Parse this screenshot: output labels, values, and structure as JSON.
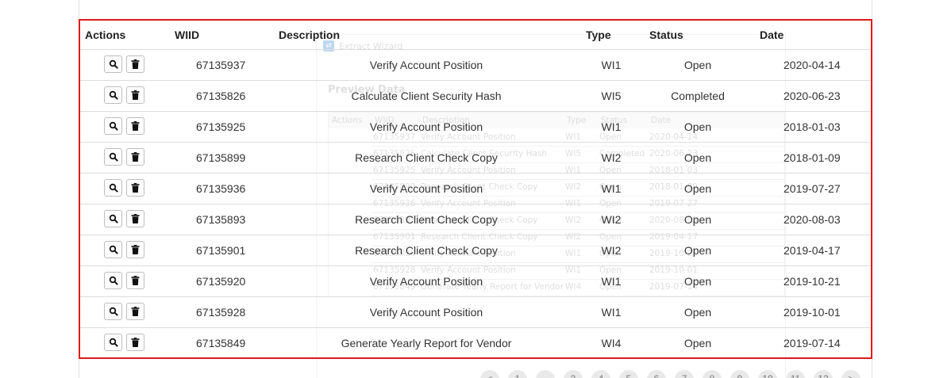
{
  "ghost_dialog": {
    "title": "Extract Wizard",
    "heading": "Preview Data",
    "columns": [
      "Actions",
      "WIID",
      "Description",
      "Type",
      "Status",
      "Date"
    ],
    "rows": [
      {
        "wiid": "67135937",
        "description": "Verify Account Position",
        "type": "WI1",
        "status": "Open",
        "date": "2020-04-14"
      },
      {
        "wiid": "67135826",
        "description": "Calculate Client Security Hash",
        "type": "WI5",
        "status": "Completed",
        "date": "2020-06-23"
      },
      {
        "wiid": "67135925",
        "description": "Verify Account Position",
        "type": "WI1",
        "status": "Open",
        "date": "2018-01-03"
      },
      {
        "wiid": "67135899",
        "description": "Research Client Check Copy",
        "type": "WI2",
        "status": "Open",
        "date": "2018-01-09"
      },
      {
        "wiid": "67135936",
        "description": "Verify Account Position",
        "type": "WI1",
        "status": "Open",
        "date": "2019-07-27"
      },
      {
        "wiid": "67135893",
        "description": "Research Client Check Copy",
        "type": "WI2",
        "status": "Open",
        "date": "2020-08-03"
      },
      {
        "wiid": "67135901",
        "description": "Research Client Check Copy",
        "type": "WI2",
        "status": "Open",
        "date": "2019-04-17"
      },
      {
        "wiid": "67135920",
        "description": "Verify Account Position",
        "type": "WI1",
        "status": "Open",
        "date": "2019-10-21"
      },
      {
        "wiid": "67135928",
        "description": "Verify Account Position",
        "type": "WI1",
        "status": "Open",
        "date": "2019-10-01"
      },
      {
        "wiid": "67135849",
        "description": "Generate Yearly Report for Vendor",
        "type": "WI4",
        "status": "Open",
        "date": "2019-07-14"
      }
    ]
  },
  "pagination": [
    "<",
    "1",
    "...",
    "3",
    "4",
    "5",
    "6",
    "7",
    "8",
    "9",
    "10",
    "11",
    "12",
    ">"
  ],
  "table": {
    "headers": {
      "actions": "Actions",
      "wiid": "WIID",
      "description": "Description",
      "type": "Type",
      "status": "Status",
      "date": "Date"
    },
    "rows": [
      {
        "wiid": "67135937",
        "description": "Verify Account Position",
        "type": "WI1",
        "status": "Open",
        "date": "2020-04-14"
      },
      {
        "wiid": "67135826",
        "description": "Calculate Client Security Hash",
        "type": "WI5",
        "status": "Completed",
        "date": "2020-06-23"
      },
      {
        "wiid": "67135925",
        "description": "Verify Account Position",
        "type": "WI1",
        "status": "Open",
        "date": "2018-01-03"
      },
      {
        "wiid": "67135899",
        "description": "Research Client Check Copy",
        "type": "WI2",
        "status": "Open",
        "date": "2018-01-09"
      },
      {
        "wiid": "67135936",
        "description": "Verify Account Position",
        "type": "WI1",
        "status": "Open",
        "date": "2019-07-27"
      },
      {
        "wiid": "67135893",
        "description": "Research Client Check Copy",
        "type": "WI2",
        "status": "Open",
        "date": "2020-08-03"
      },
      {
        "wiid": "67135901",
        "description": "Research Client Check Copy",
        "type": "WI2",
        "status": "Open",
        "date": "2019-04-17"
      },
      {
        "wiid": "67135920",
        "description": "Verify Account Position",
        "type": "WI1",
        "status": "Open",
        "date": "2019-10-21"
      },
      {
        "wiid": "67135928",
        "description": "Verify Account Position",
        "type": "WI1",
        "status": "Open",
        "date": "2019-10-01"
      },
      {
        "wiid": "67135849",
        "description": "Generate Yearly Report for Vendor",
        "type": "WI4",
        "status": "Open",
        "date": "2019-07-14"
      }
    ],
    "row_actions": [
      "search-icon",
      "trash-icon"
    ]
  },
  "colors": {
    "highlight_border": "#e0191b",
    "row_divider": "#dddddd",
    "button_border": "#bdbdbd"
  }
}
